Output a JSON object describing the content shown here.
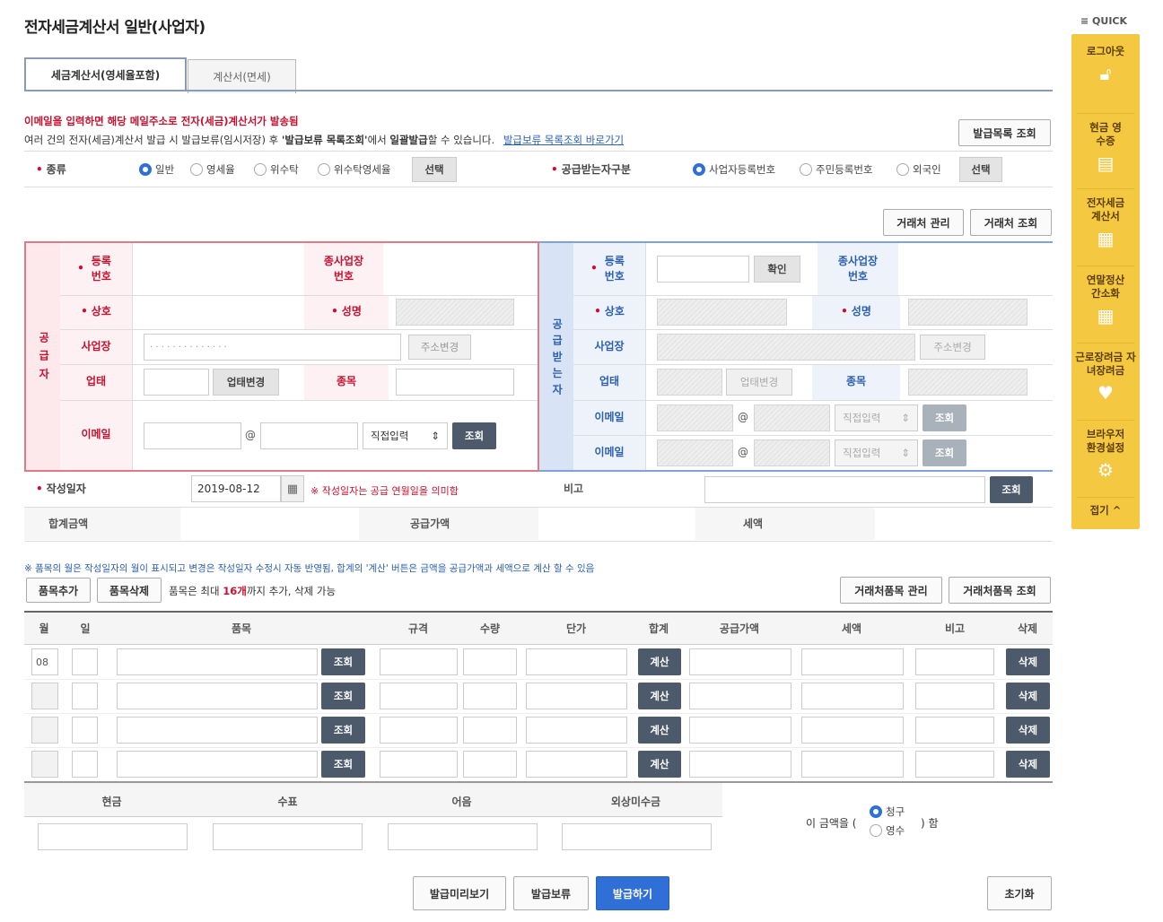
{
  "page": {
    "title": "전자세금계산서 일반(사업자)"
  },
  "quick": {
    "header": "≡ QUICK",
    "items": [
      "로그아웃",
      "현금 영수증",
      "전자세금 계산서",
      "연말정산 간소화",
      "근로장려금 자녀장려금",
      "브라우저 환경설정"
    ],
    "collapse": "접기 ^"
  },
  "tabs": [
    "세금계산서(영세율포함)",
    "계산서(면세)"
  ],
  "notices": {
    "line1": "이메일을 입력하면 해당 메일주소로 전자(세금)계산서가 발송됨",
    "line2_pre": "여러 건의 전자(세금)계산서 발급 시 발급보류(임시저장) 후 ",
    "line2_bold1": "'발급보류 목록조회'",
    "line2_mid": "에서 ",
    "line2_bold2": "일괄발급",
    "line2_post": "할 수 있습니다.",
    "line2_link": "발급보류 목록조회 바로가기"
  },
  "buttons": {
    "issue_list": "발급목록 조회",
    "partner_manage": "거래처 관리",
    "partner_search": "거래처 조회",
    "select": "선택",
    "confirm": "확인",
    "addr_change": "주소변경",
    "biz_change": "업태변경",
    "search": "조회",
    "item_add": "품목추가",
    "item_delete": "품목삭제",
    "partner_item_manage": "거래처품목 관리",
    "partner_item_search": "거래처품목 조회",
    "calc": "계산",
    "delete": "삭제",
    "preview": "발급미리보기",
    "hold": "발급보류",
    "issue": "발급하기",
    "reset": "초기화"
  },
  "kind": {
    "label": "종류",
    "options": [
      "일반",
      "영세율",
      "위수탁",
      "위수탁영세율"
    ],
    "selected": "일반"
  },
  "receiver_type": {
    "label": "공급받는자구분",
    "options": [
      "사업자등록번호",
      "주민등록번호",
      "외국인"
    ],
    "selected": "사업자등록번호"
  },
  "supplier": {
    "side_label": "공 급 자",
    "reg_no": "등록 번호",
    "sub_biz": "종사업장 번호",
    "company": "상호",
    "name": "성명",
    "address": "사업장",
    "address_value": "· · · · · · · · · · · · · ·",
    "biz_type": "업태",
    "biz_item": "종목",
    "email": "이메일",
    "at": "@",
    "domain_select": "직접입력"
  },
  "buyer": {
    "side_label": "공 급 받 는 자",
    "reg_no": "등록 번호",
    "sub_biz": "종사업장 번호",
    "company": "상호",
    "name": "성명",
    "address": "사업장",
    "biz_type": "업태",
    "biz_item": "종목",
    "email1": "이메일",
    "email2": "이메일",
    "at": "@",
    "domain_select": "직접입력"
  },
  "write_date": {
    "label": "작성일자",
    "value": "2019-08-12",
    "hint": "※ 작성일자는 공급 연월일을 의미함",
    "remark_label": "비고"
  },
  "totals": {
    "total": "합계금액",
    "supply": "공급가액",
    "tax": "세액"
  },
  "items_note": "※ 품목의 월은 작성일자의 월이 표시되고 변경은 작성일자 수정시 자동 반영됨, 합계의 '계산' 버튼은 금액을 공급가액과 세액으로 계산 할 수 있음",
  "items_limit": {
    "pre": "품목은 최대 ",
    "num": "16개",
    "post": "까지 추가, 삭제 가능"
  },
  "table": {
    "headers": [
      "월",
      "일",
      "품목",
      "규격",
      "수량",
      "단가",
      "합계",
      "공급가액",
      "세액",
      "비고",
      "삭제"
    ],
    "rows": [
      {
        "month": "08"
      },
      {
        "month": ""
      },
      {
        "month": ""
      },
      {
        "month": ""
      }
    ]
  },
  "payment": {
    "headers": [
      "현금",
      "수표",
      "어음",
      "외상미수금"
    ],
    "pre": "이 금액을 (",
    "options": [
      "청구",
      "영수"
    ],
    "selected": "청구",
    "post": ") 함"
  }
}
